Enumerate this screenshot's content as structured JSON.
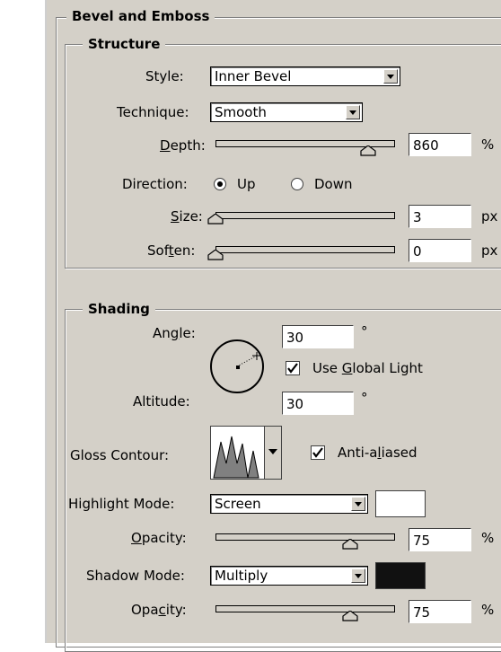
{
  "panel": {
    "title": "Bevel and Emboss"
  },
  "structure": {
    "title": "Structure",
    "style": {
      "label": "Style:",
      "value": "Inner Bevel"
    },
    "technique": {
      "label": "Technique:",
      "value": "Smooth"
    },
    "depth": {
      "label_pre": "",
      "label_u": "D",
      "label_post": "epth:",
      "value": "860",
      "unit": "%",
      "slider_fraction": 0.85
    },
    "direction": {
      "label": "Direction:",
      "options": [
        "Up",
        "Down"
      ],
      "selected": "Up"
    },
    "size": {
      "label_pre": "",
      "label_u": "S",
      "label_post": "ize:",
      "value": "3",
      "unit": "px",
      "slider_fraction": 0.0
    },
    "soften": {
      "label_pre": "Sof",
      "label_u": "t",
      "label_post": "en:",
      "value": "0",
      "unit": "px",
      "slider_fraction": 0.0
    }
  },
  "shading": {
    "title": "Shading",
    "angle": {
      "label_pre": "An",
      "label_u": "g",
      "label_post": "le:",
      "value": "30",
      "unit": "°"
    },
    "use_global_light": {
      "label_pre": "Use ",
      "label_u": "G",
      "label_post": "lobal Light",
      "checked": true
    },
    "altitude": {
      "label": "Altitude:",
      "value": "30",
      "unit": "°"
    },
    "gloss_contour": {
      "label": "Gloss Contour:"
    },
    "anti_aliased": {
      "label_pre": "Anti-a",
      "label_u": "l",
      "label_post": "iased",
      "checked": true
    },
    "highlight_mode": {
      "label": "Highlight Mode:",
      "value": "Screen",
      "color": "#ffffff"
    },
    "highlight_opacity": {
      "label_pre": "",
      "label_u": "O",
      "label_post": "pacity:",
      "value": "75",
      "unit": "%",
      "slider_fraction": 0.75
    },
    "shadow_mode": {
      "label": "Shadow Mode:",
      "value": "Multiply",
      "color": "#111111"
    },
    "shadow_opacity": {
      "label_pre": "Opa",
      "label_u": "c",
      "label_post": "ity:",
      "value": "75",
      "unit": "%",
      "slider_fraction": 0.75
    }
  }
}
